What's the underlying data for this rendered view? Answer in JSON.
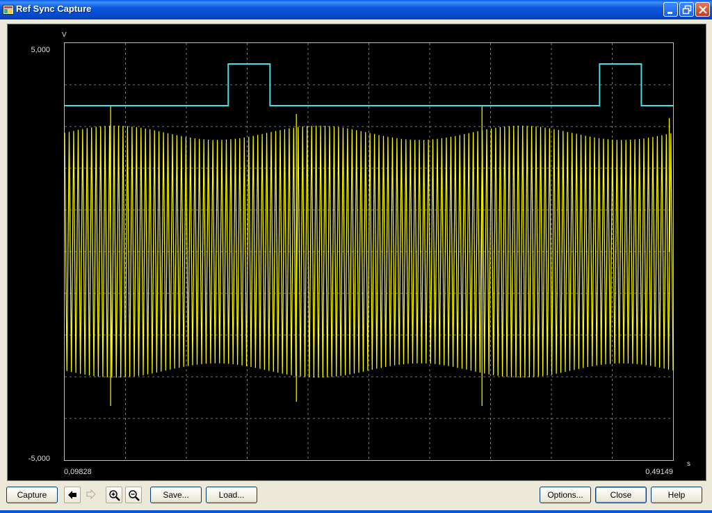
{
  "window": {
    "title": "Ref Sync Capture",
    "controls": [
      "minimize-icon",
      "restore-icon",
      "close-icon"
    ]
  },
  "chart_data": {
    "type": "line",
    "xlabel": "s",
    "ylabel": "V",
    "xlim": [
      0.09828,
      0.49149
    ],
    "ylim": [
      -5.0,
      5.0
    ],
    "x_tick_labels": [
      "0,09828",
      "0,49149"
    ],
    "y_tick_labels": [
      "5,000",
      "-5,000"
    ],
    "grid": true,
    "series": [
      {
        "color": "#40e0e8",
        "style": "square-pulse",
        "low_value": 3.5,
        "high_value": 4.5,
        "pulses": [
          [
            0.204,
            0.231
          ],
          [
            0.444,
            0.471
          ]
        ]
      },
      {
        "color": "#ffff00",
        "style": "oscillation",
        "center": 0.0,
        "amplitude": 2.85,
        "frequency_hz": 345,
        "spikes": [
          {
            "x": 0.128,
            "top": 3.5,
            "bottom": -3.7
          },
          {
            "x": 0.248,
            "top": 3.3,
            "bottom": -3.6
          },
          {
            "x": 0.368,
            "top": 3.5,
            "bottom": -3.7
          },
          {
            "x": 0.489,
            "top": 3.2,
            "bottom": 0.0
          }
        ]
      }
    ]
  },
  "buttons": {
    "capture": "Capture",
    "save": "Save...",
    "load": "Load...",
    "options": "Options...",
    "close": "Close",
    "help": "Help"
  },
  "toolbar_icons": [
    "arrow-left-icon",
    "arrow-right-icon",
    "zoom-in-icon",
    "zoom-out-icon"
  ]
}
